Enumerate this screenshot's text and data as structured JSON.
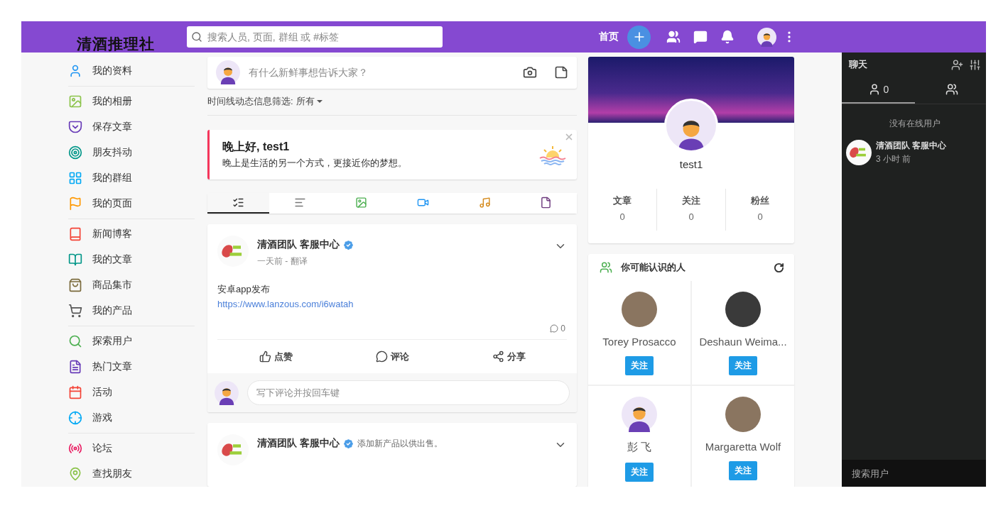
{
  "header": {
    "logo": "清酒推理社",
    "search": {
      "placeholder": "搜索人员, 页面, 群组 或 #标签"
    },
    "home_link": "首页"
  },
  "sidebar": {
    "groups": [
      {
        "items": [
          {
            "label": "我的资料",
            "color": "#2196f3"
          }
        ]
      },
      {
        "items": [
          {
            "label": "我的相册",
            "color": "#8bc34a"
          },
          {
            "label": "保存文章",
            "color": "#673ab7"
          },
          {
            "label": "朋友抖动",
            "color": "#009688"
          },
          {
            "label": "我的群组",
            "color": "#03a9f4"
          },
          {
            "label": "我的页面",
            "color": "#ff9800"
          }
        ]
      },
      {
        "items": [
          {
            "label": "新闻博客",
            "color": "#f44336"
          },
          {
            "label": "我的文章",
            "color": "#009688"
          },
          {
            "label": "商品集市",
            "color": "#7a6a3b"
          },
          {
            "label": "我的产品",
            "color": "#555555"
          }
        ]
      },
      {
        "items": [
          {
            "label": "探索用户",
            "color": "#4caf50"
          },
          {
            "label": "热门文章",
            "color": "#673ab7"
          },
          {
            "label": "活动",
            "color": "#f44336"
          },
          {
            "label": "游戏",
            "color": "#03a9f4"
          }
        ]
      },
      {
        "items": [
          {
            "label": "论坛",
            "color": "#e91e63"
          },
          {
            "label": "查找朋友",
            "color": "#8bc34a"
          }
        ]
      }
    ]
  },
  "composer": {
    "placeholder": "有什么新鲜事想告诉大家？"
  },
  "filter": {
    "label": "时间线动态信息筛选:",
    "value": "所有"
  },
  "greeting": {
    "title": "晚上好, test1",
    "text": "晚上是生活的另一个方式，更接近你的梦想。"
  },
  "feed_tabs": [
    {
      "selected": true
    },
    {
      "selected": false
    },
    {
      "selected": false
    },
    {
      "selected": false
    },
    {
      "selected": false
    },
    {
      "selected": false
    }
  ],
  "posts": [
    {
      "author": "清酒团队 客服中心",
      "verified": true,
      "time": "一天前 - 翻译",
      "body": "安卓app发布",
      "link": "https://www.lanzous.com/i6watah",
      "comments": "0",
      "actions": [
        "点赞",
        "评论",
        "分享"
      ],
      "comment_placeholder": "写下评论并按回车键"
    },
    {
      "author": "清酒团队 客服中心",
      "verified": true,
      "action": "添加新产品以供出售。"
    }
  ],
  "profile": {
    "name": "test1",
    "stats": [
      {
        "label": "文章",
        "value": "0"
      },
      {
        "label": "关注",
        "value": "0"
      },
      {
        "label": "粉丝",
        "value": "0"
      }
    ]
  },
  "suggestions": {
    "title": "你可能认识的人",
    "people": [
      {
        "name": "Torey Prosacco",
        "kind": "photo",
        "button": "关注"
      },
      {
        "name": "Deshaun Weima...",
        "kind": "photo",
        "button": "关注"
      },
      {
        "name": "彭 飞",
        "kind": "avatar",
        "button": "关注"
      },
      {
        "name": "Margaretta Wolf",
        "kind": "photo",
        "button": "关注"
      }
    ]
  },
  "chat": {
    "title": "聊天",
    "tabs": [
      {
        "count": "0",
        "selected": true
      },
      {
        "selected": false
      }
    ],
    "empty": "没有在线用户",
    "conversations": [
      {
        "name": "清酒团队 客服中心",
        "time": "3 小时 前"
      }
    ],
    "search": {
      "placeholder": "搜索用户"
    }
  }
}
